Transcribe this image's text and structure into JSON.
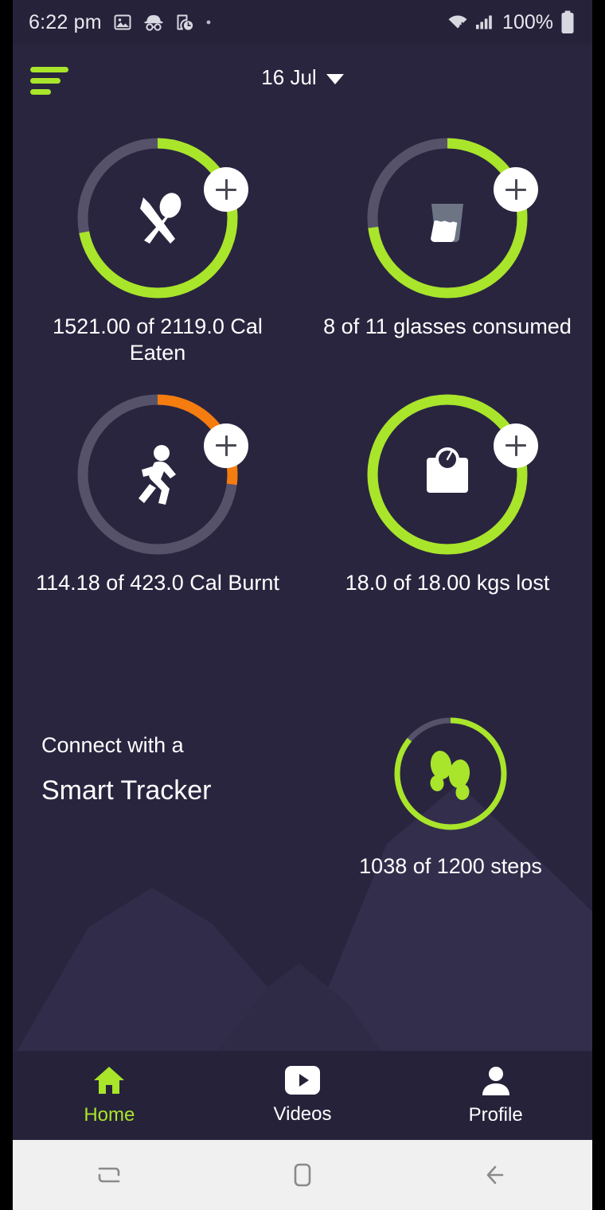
{
  "theme": {
    "background": "#29253f",
    "bar_background": "#26223a",
    "accent_green": "#a9e52a",
    "accent_orange": "#f57c0f",
    "track_gray": "#56526a",
    "text_primary": "#ffffff",
    "sysnav_background": "#f0f0f0"
  },
  "status_bar": {
    "time": "6:22 pm",
    "battery_percent": "100%",
    "left_icons": [
      "image-icon",
      "incognito-icon",
      "screen-time-icon",
      "dot-icon"
    ],
    "right_icons": [
      "wifi-icon",
      "signal-icon",
      "battery-icon"
    ]
  },
  "header": {
    "menu_icon": "hamburger-icon",
    "date": "16 Jul",
    "date_caret": "chevron-down-icon"
  },
  "rings": [
    {
      "name": "calories-eaten",
      "icon": "cutlery-icon",
      "label": "1521.00 of 2119.0 Cal Eaten",
      "current": 1521.0,
      "goal": 2119.0,
      "unit": "Cal",
      "percent": 72,
      "color": "#a9e52a",
      "add_button": "add-icon"
    },
    {
      "name": "water-glasses",
      "icon": "water-glass-icon",
      "label": "8 of 11 glasses consumed",
      "current": 8,
      "goal": 11,
      "unit": "glasses",
      "percent": 73,
      "color": "#a9e52a",
      "add_button": "add-icon"
    },
    {
      "name": "calories-burnt",
      "icon": "running-icon",
      "label": "114.18 of 423.0 Cal Burnt",
      "current": 114.18,
      "goal": 423.0,
      "unit": "Cal",
      "percent": 27,
      "color": "#f57c0f",
      "add_button": "add-icon"
    },
    {
      "name": "weight-lost",
      "icon": "weight-scale-icon",
      "label": "18.0 of 18.00 kgs lost",
      "current": 18.0,
      "goal": 18.0,
      "unit": "kgs",
      "percent": 100,
      "color": "#a9e52a",
      "add_button": "add-icon"
    }
  ],
  "promo": {
    "line1": "Connect with a",
    "line2": "Smart Tracker"
  },
  "steps": {
    "name": "steps-tracker",
    "icon": "footprints-icon",
    "label": "1038 of 1200 steps",
    "current": 1038,
    "goal": 1200,
    "percent": 86,
    "color": "#a9e52a"
  },
  "bottom_nav": {
    "items": [
      {
        "label": "Home",
        "icon": "home-icon",
        "active": true
      },
      {
        "label": "Videos",
        "icon": "video-icon",
        "active": false
      },
      {
        "label": "Profile",
        "icon": "person-icon",
        "active": false
      }
    ]
  },
  "system_nav": {
    "items": [
      "recents-icon",
      "home-square-icon",
      "back-arrow-icon"
    ]
  }
}
